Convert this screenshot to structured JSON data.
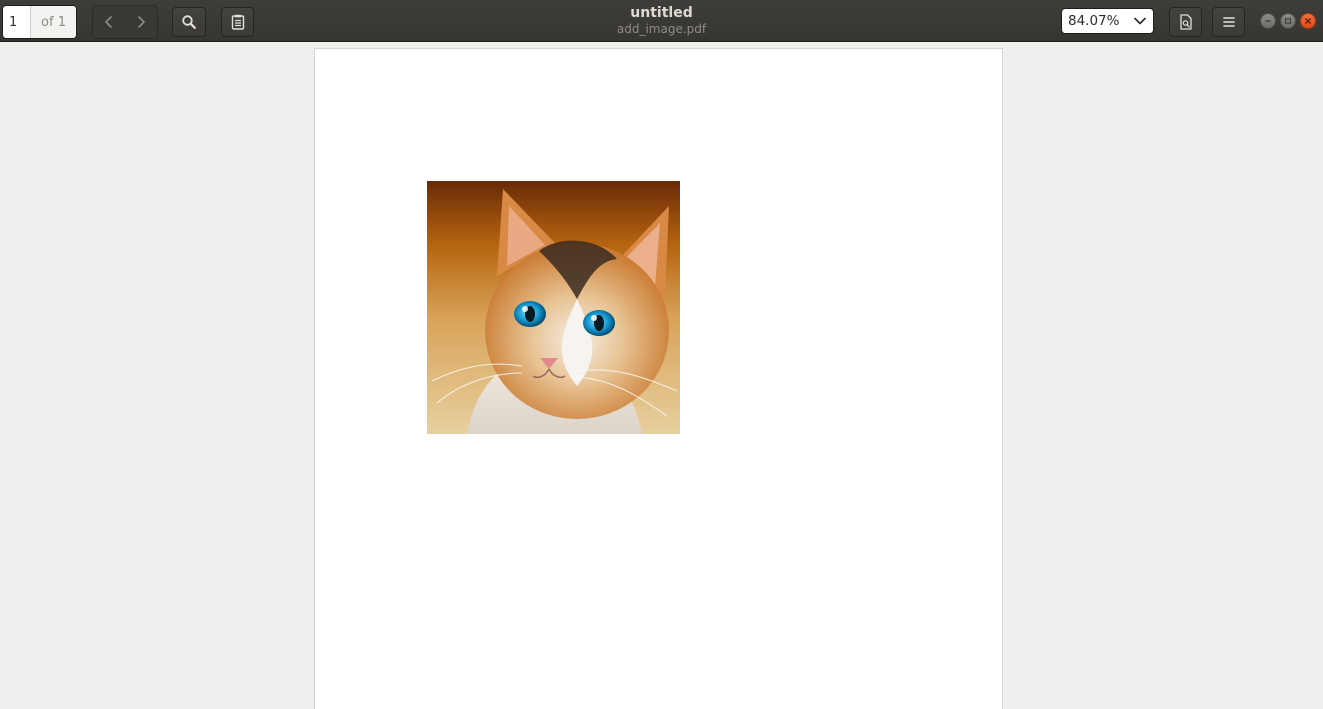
{
  "toolbar": {
    "page_number": "1",
    "page_count_label": "of 1",
    "zoom_value": "84.07%",
    "icons": {
      "previous": "chevron-left-icon",
      "next": "chevron-right-icon",
      "search": "search-icon",
      "annotations": "clipboard-icon",
      "document_properties": "document-search-icon",
      "menu": "hamburger-menu-icon",
      "zoom_dropdown": "chevron-down-icon"
    }
  },
  "window": {
    "title": "untitled",
    "subtitle": "add_image.pdf",
    "controls": [
      "minimize",
      "maximize",
      "close"
    ],
    "close_color": "#e9541d"
  },
  "document": {
    "page_background": "#ffffff",
    "image_subject": "cat portrait"
  }
}
